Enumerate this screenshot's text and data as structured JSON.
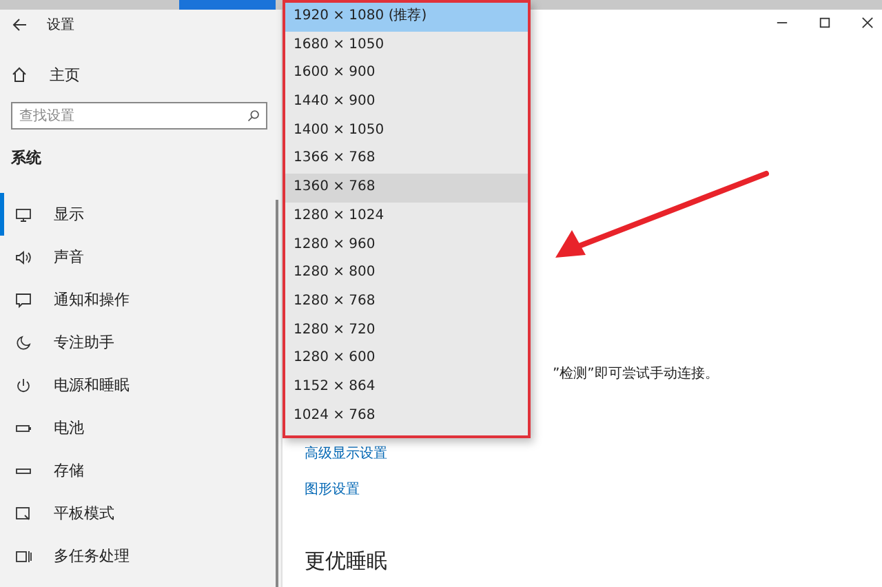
{
  "window": {
    "title": "设置"
  },
  "sidebar": {
    "home": "主页",
    "search": {
      "placeholder": "查找设置"
    },
    "section": "系统",
    "items": [
      {
        "label": "显示",
        "selected": true
      },
      {
        "label": "声音",
        "selected": false
      },
      {
        "label": "通知和操作",
        "selected": false
      },
      {
        "label": "专注助手",
        "selected": false
      },
      {
        "label": "电源和睡眠",
        "selected": false
      },
      {
        "label": "电池",
        "selected": false
      },
      {
        "label": "存储",
        "selected": false
      },
      {
        "label": "平板模式",
        "selected": false
      },
      {
        "label": "多任务处理",
        "selected": false
      }
    ]
  },
  "resolution_menu": {
    "options": [
      {
        "label": "1920 × 1080 (推荐)",
        "selected": true,
        "hovered": false
      },
      {
        "label": "1680 × 1050",
        "selected": false,
        "hovered": false
      },
      {
        "label": "1600 × 900",
        "selected": false,
        "hovered": false
      },
      {
        "label": "1440 × 900",
        "selected": false,
        "hovered": false
      },
      {
        "label": "1400 × 1050",
        "selected": false,
        "hovered": false
      },
      {
        "label": "1366 × 768",
        "selected": false,
        "hovered": false
      },
      {
        "label": "1360 × 768",
        "selected": false,
        "hovered": true
      },
      {
        "label": "1280 × 1024",
        "selected": false,
        "hovered": false
      },
      {
        "label": "1280 × 960",
        "selected": false,
        "hovered": false
      },
      {
        "label": "1280 × 800",
        "selected": false,
        "hovered": false
      },
      {
        "label": "1280 × 768",
        "selected": false,
        "hovered": false
      },
      {
        "label": "1280 × 720",
        "selected": false,
        "hovered": false
      },
      {
        "label": "1280 × 600",
        "selected": false,
        "hovered": false
      },
      {
        "label": "1152 × 864",
        "selected": false,
        "hovered": false
      },
      {
        "label": "1024 × 768",
        "selected": false,
        "hovered": false
      }
    ]
  },
  "main": {
    "detect_hint": "”检测”即可尝试手动连接。",
    "links": [
      "高级显示设置",
      "图形设置"
    ],
    "night_heading": "更优睡眠"
  }
}
